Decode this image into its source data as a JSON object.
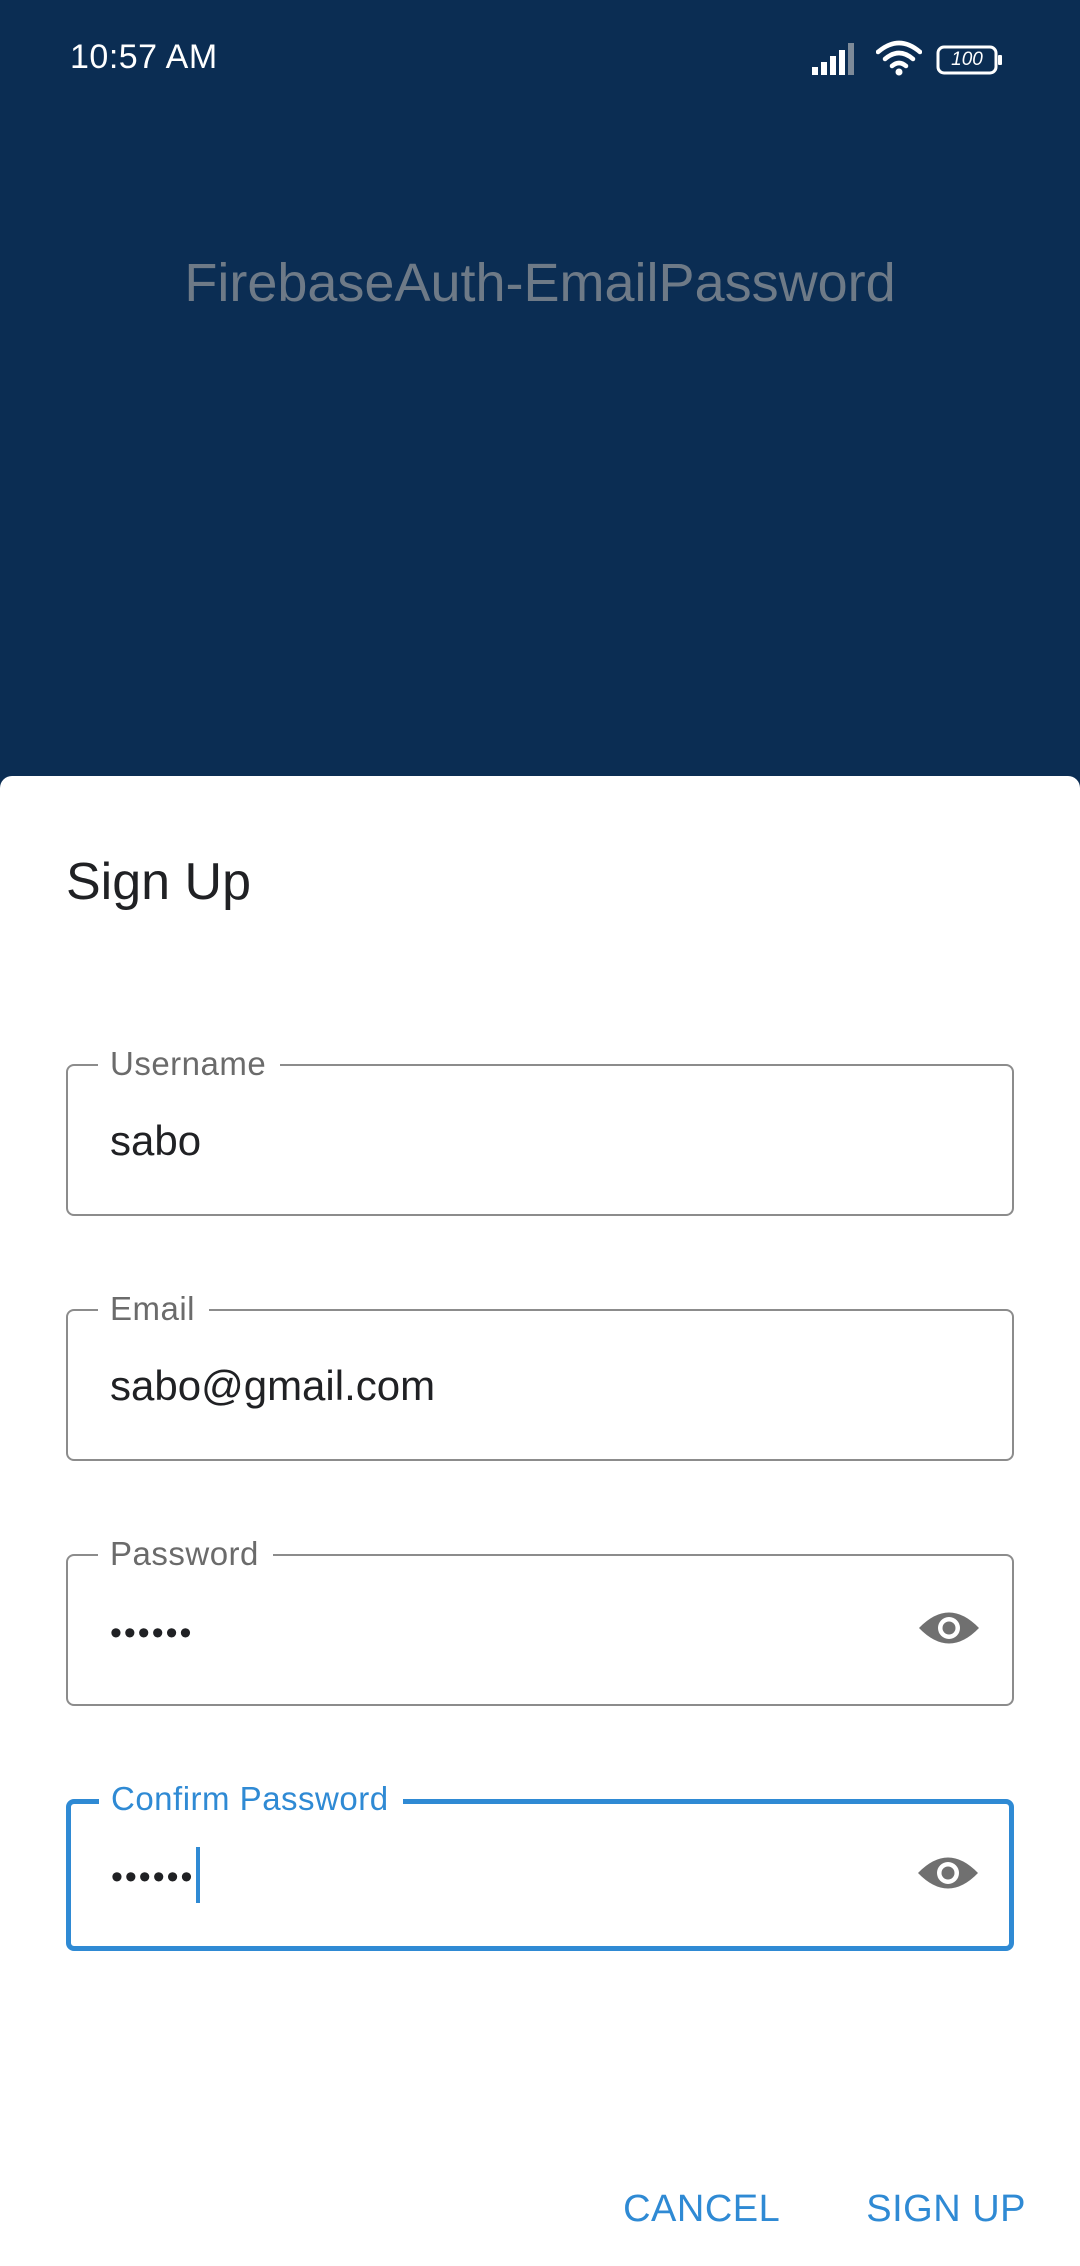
{
  "status_bar": {
    "time": "10:57 AM",
    "battery": "100",
    "icons": [
      "signal-icon",
      "wifi-icon",
      "battery-icon"
    ]
  },
  "app": {
    "title": "FirebaseAuth-EmailPassword"
  },
  "dialog": {
    "title": "Sign Up",
    "fields": {
      "username": {
        "label": "Username",
        "value": "sabo"
      },
      "email": {
        "label": "Email",
        "value": "sabo@gmail.com"
      },
      "password": {
        "label": "Password",
        "value": "••••••"
      },
      "confirm_password": {
        "label": "Confirm Password",
        "value": "••••••"
      }
    },
    "actions": {
      "cancel": "CANCEL",
      "sign_up": "SIGN UP"
    }
  },
  "colors": {
    "app_background": "#0b2d53",
    "accent": "#2f8ad4",
    "outline": "#8c8c8c",
    "title_text": "#6e7a87"
  }
}
